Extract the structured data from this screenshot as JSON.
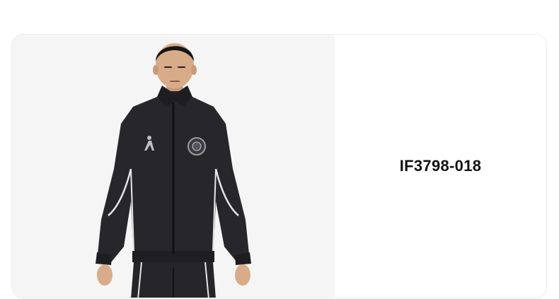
{
  "product": {
    "code": "IF3798-018",
    "image_icon": "product-photo-jacket"
  },
  "colors": {
    "card_bg": "#ffffff",
    "image_bg": "#f5f5f5",
    "jacket": "#26262b",
    "piping": "#e6e6e6",
    "text": "#111111"
  }
}
